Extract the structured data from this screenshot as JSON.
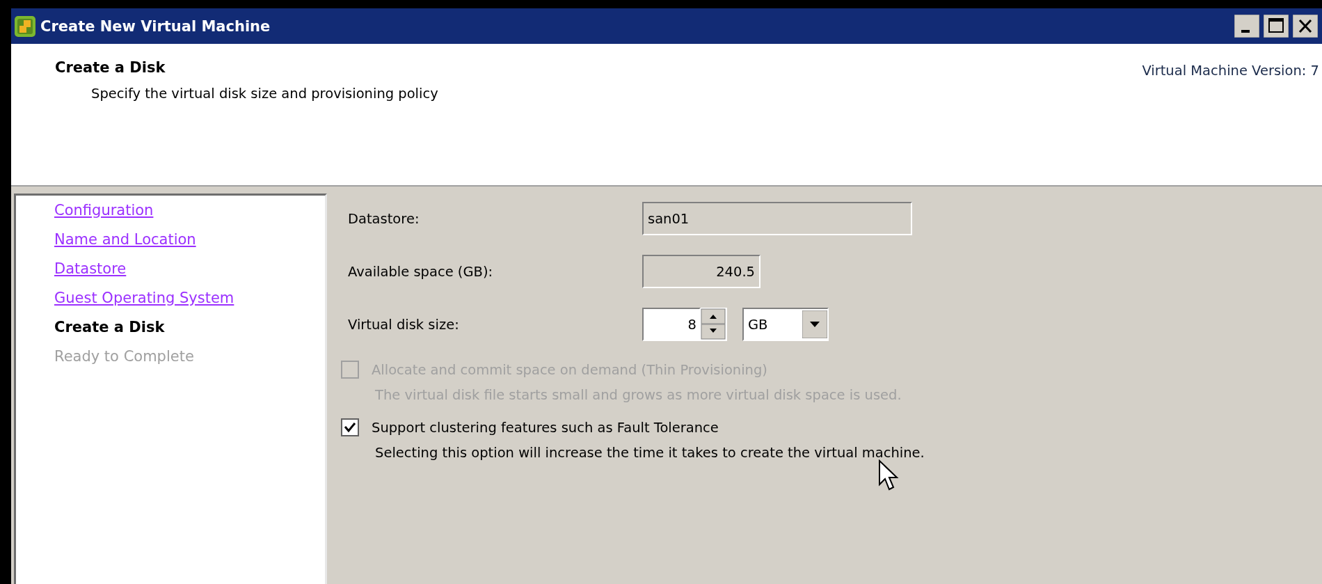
{
  "window": {
    "title": "Create New Virtual Machine"
  },
  "header": {
    "title": "Create a Disk",
    "subtitle": "Specify the virtual disk size and provisioning policy",
    "version": "Virtual Machine Version: 7"
  },
  "steps": [
    {
      "label": "Configuration",
      "kind": "done"
    },
    {
      "label": "Name and Location",
      "kind": "done"
    },
    {
      "label": "Datastore",
      "kind": "done"
    },
    {
      "label": "Guest Operating System",
      "kind": "done"
    },
    {
      "label": "Create a Disk",
      "kind": "current"
    },
    {
      "label": "Ready to Complete",
      "kind": "pending"
    }
  ],
  "form": {
    "datastore": {
      "label": "Datastore:",
      "value": "san01"
    },
    "available_space": {
      "label": "Available space (GB):",
      "value": "240.5"
    },
    "disk_size": {
      "label": "Virtual disk size:",
      "value": "8",
      "unit": "GB"
    }
  },
  "options": [
    {
      "label": "Allocate and commit space on demand (Thin Provisioning)",
      "description": "The virtual disk file starts small and grows as more virtual disk space is used.",
      "checked": false,
      "disabled": true
    },
    {
      "label": "Support clustering features such as Fault Tolerance",
      "description": "Selecting this option will increase the time it takes to create the virtual machine.",
      "checked": true,
      "disabled": false
    }
  ]
}
